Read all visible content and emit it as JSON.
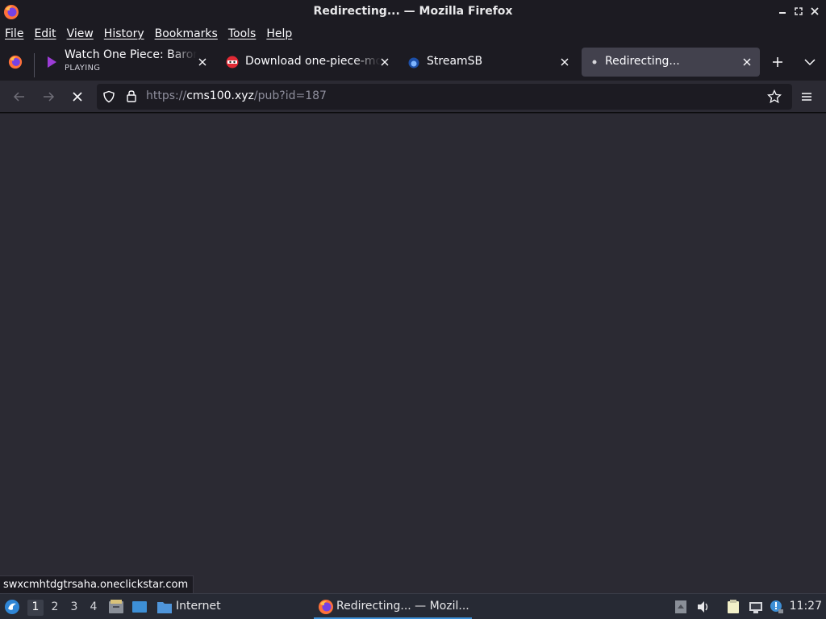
{
  "window": {
    "title": "Redirecting... — Mozilla Firefox"
  },
  "menubar": {
    "items": [
      "File",
      "Edit",
      "View",
      "History",
      "Bookmarks",
      "Tools",
      "Help"
    ]
  },
  "tabs": [
    {
      "label": "Watch One Piece: Baron O",
      "sublabel": "PLAYING",
      "favicon": "play-icon",
      "active": false
    },
    {
      "label": "Download one-piece-movie",
      "favicon": "ninja-mask-icon",
      "active": false
    },
    {
      "label": "StreamSB",
      "favicon": "streamsb-icon",
      "active": false
    },
    {
      "label": "Redirecting...",
      "favicon": "loading-dot-icon",
      "active": true
    }
  ],
  "navbar": {
    "url_prefix": "https://",
    "url_host": "cms100.xyz",
    "url_path": "/pub?id=187"
  },
  "statusbar": {
    "link": "swxcmhtdgtrsaha.oneclickstar.com"
  },
  "taskbar": {
    "workspaces": [
      "1",
      "2",
      "3",
      "4"
    ],
    "active_workspace": "1",
    "launcher_label": "Internet",
    "window_label": "Redirecting... — Mozil...",
    "clock": "11:27"
  },
  "colors": {
    "accent": "#3d8fd6",
    "chrome_bg": "#1c1b22",
    "toolbar_bg": "#2b2a33",
    "active_tab": "#42414d"
  }
}
